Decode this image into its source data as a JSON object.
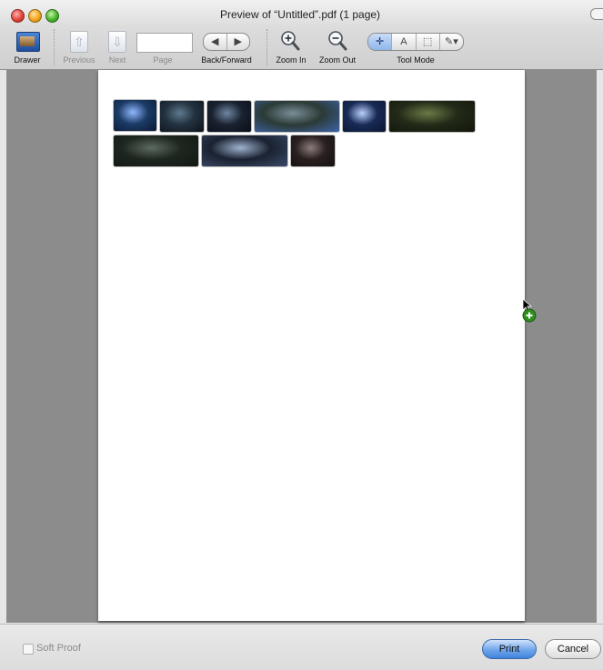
{
  "window": {
    "title": "Preview of “Untitled”.pdf (1 page)"
  },
  "toolbar": {
    "drawer_label": "Drawer",
    "previous_label": "Previous",
    "next_label": "Next",
    "page_label": "Page",
    "page_value": "",
    "back_forward_label": "Back/Forward",
    "zoom_in_label": "Zoom In",
    "zoom_out_label": "Zoom Out",
    "tool_mode_label": "Tool Mode",
    "back_symbol": "◀",
    "forward_symbol": "▶",
    "tool_modes": [
      {
        "symbol": "✛",
        "name": "move-tool",
        "active": true
      },
      {
        "symbol": "A",
        "name": "text-tool",
        "active": false
      },
      {
        "symbol": "⬚",
        "name": "select-tool",
        "active": false
      },
      {
        "symbol": "✎▾",
        "name": "annotate-tool",
        "active": false
      }
    ]
  },
  "document": {
    "thumbnails": [
      {
        "name": "thumb-1",
        "colors": [
          "#1b3b66",
          "#8fb8ff",
          "#0b1a33"
        ]
      },
      {
        "name": "thumb-2",
        "colors": [
          "#23313f",
          "#5c7a8e",
          "#0d141b"
        ]
      },
      {
        "name": "thumb-3",
        "colors": [
          "#1a2230",
          "#6f86a3",
          "#0a0f18"
        ]
      },
      {
        "name": "thumb-4",
        "colors": [
          "#2b3a35",
          "#7a8e99",
          "#3d64a8"
        ]
      },
      {
        "name": "thumb-5",
        "colors": [
          "#182a55",
          "#b9d0ff",
          "#0a1733"
        ]
      },
      {
        "name": "thumb-6",
        "colors": [
          "#232a18",
          "#697a45",
          "#12160c"
        ]
      },
      {
        "name": "thumb-7",
        "colors": [
          "#1e2620",
          "#5d6b60",
          "#121712"
        ]
      },
      {
        "name": "thumb-8",
        "colors": [
          "#1a2230",
          "#9fb3d1",
          "#3a4a6a"
        ]
      },
      {
        "name": "thumb-9",
        "colors": [
          "#2a2020",
          "#8c7c7c",
          "#141010"
        ]
      }
    ]
  },
  "bottom": {
    "soft_proof_label": "Soft Proof",
    "soft_proof_checked": false,
    "print_label": "Print",
    "cancel_label": "Cancel"
  }
}
